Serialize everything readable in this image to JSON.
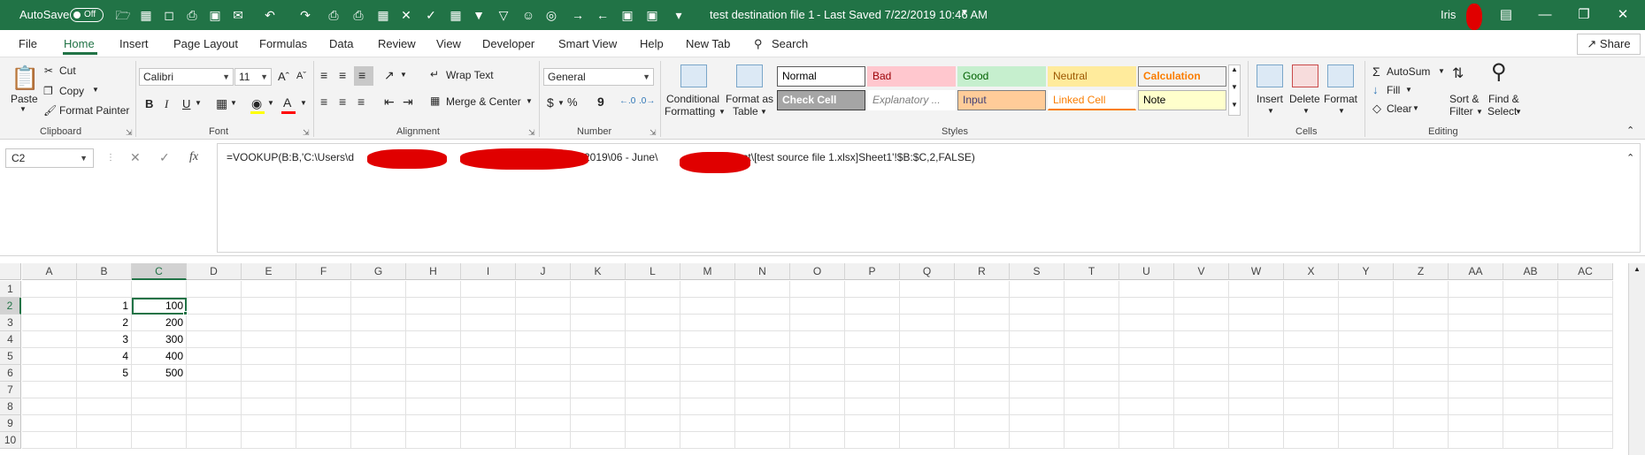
{
  "titlebar": {
    "autosave_label": "AutoSave",
    "autosave_state": "Off",
    "document_title": "test destination file 1",
    "saved_status": "-  Last Saved 7/22/2019 10:46 AM",
    "user_name": "Iris",
    "accent_color": "#217346"
  },
  "menu": {
    "items": [
      "File",
      "Home",
      "Insert",
      "Page Layout",
      "Formulas",
      "Data",
      "Review",
      "View",
      "Developer",
      "Smart View",
      "Help",
      "New Tab"
    ],
    "active": "Home",
    "search_label": "Search",
    "share_label": "Share"
  },
  "ribbon": {
    "clipboard": {
      "paste": "Paste",
      "cut": "Cut",
      "copy": "Copy",
      "format_painter": "Format Painter",
      "group_label": "Clipboard"
    },
    "font": {
      "font_name": "Calibri",
      "font_size": "11",
      "bold": "B",
      "italic": "I",
      "underline": "U",
      "group_label": "Font"
    },
    "alignment": {
      "wrap_text": "Wrap Text",
      "merge_center": "Merge & Center",
      "group_label": "Alignment"
    },
    "number": {
      "format": "General",
      "currency": "$",
      "percent": "%",
      "comma": "9",
      "group_label": "Number"
    },
    "styles": {
      "conditional_formatting_1": "Conditional",
      "conditional_formatting_2": "Formatting",
      "format_as_table_1": "Format as",
      "format_as_table_2": "Table",
      "tiles": [
        {
          "label": "Normal",
          "bg": "#ffffff",
          "fg": "#000000",
          "border": "#5a5a5a"
        },
        {
          "label": "Bad",
          "bg": "#ffc7ce",
          "fg": "#9c0006",
          "border": "#ffc7ce"
        },
        {
          "label": "Good",
          "bg": "#c6efce",
          "fg": "#006100",
          "border": "#c6efce"
        },
        {
          "label": "Neutral",
          "bg": "#ffeb9c",
          "fg": "#9c5700",
          "border": "#ffeb9c"
        },
        {
          "label": "Calculation",
          "bg": "#f2f2f2",
          "fg": "#fa7d00",
          "border": "#7f7f7f"
        },
        {
          "label": "Check Cell",
          "bg": "#a5a5a5",
          "fg": "#ffffff",
          "border": "#3f3f3f"
        },
        {
          "label": "Explanatory ...",
          "bg": "#ffffff",
          "fg": "#7f7f7f",
          "border": "#ffffff"
        },
        {
          "label": "Input",
          "bg": "#ffcc99",
          "fg": "#3f3f76",
          "border": "#7f7f7f"
        },
        {
          "label": "Linked Cell",
          "bg": "#ffffff",
          "fg": "#fa7d00",
          "border": "#ffffff"
        },
        {
          "label": "Note",
          "bg": "#ffffcc",
          "fg": "#000000",
          "border": "#b2b2b2"
        }
      ],
      "group_label": "Styles"
    },
    "cells": {
      "insert": "Insert",
      "delete": "Delete",
      "format": "Format",
      "group_label": "Cells"
    },
    "editing": {
      "autosum": "AutoSum",
      "fill": "Fill",
      "clear": "Clear",
      "sort_filter_1": "Sort &",
      "sort_filter_2": "Filter",
      "find_select_1": "Find &",
      "find_select_2": "Select",
      "group_label": "Editing"
    }
  },
  "formula_bar": {
    "name_box": "C2",
    "fx": "fx",
    "formula_part1": "=VOOKUP(B:B,'C:\\Users\\d",
    "formula_part2": "2019\\06 - June\\",
    "formula_part3": "\\Test\\[test source file 1.xlsx]Sheet1'!$B:$C,2,FALSE)"
  },
  "grid": {
    "columns": [
      "A",
      "B",
      "C",
      "D",
      "E",
      "F",
      "G",
      "H",
      "I",
      "J",
      "K",
      "L",
      "M",
      "N",
      "O",
      "P",
      "Q",
      "R",
      "S",
      "T",
      "U",
      "V",
      "W",
      "X",
      "Y",
      "Z",
      "AA",
      "AB",
      "AC"
    ],
    "rows": [
      "1",
      "2",
      "3",
      "4",
      "5",
      "6",
      "7",
      "8",
      "9",
      "10"
    ],
    "selected_column": "C",
    "selected_row": "2",
    "data": [
      {
        "row": "2",
        "b": "1",
        "c": "100"
      },
      {
        "row": "3",
        "b": "2",
        "c": "200"
      },
      {
        "row": "4",
        "b": "3",
        "c": "300"
      },
      {
        "row": "5",
        "b": "4",
        "c": "400"
      },
      {
        "row": "6",
        "b": "5",
        "c": "500"
      }
    ]
  }
}
